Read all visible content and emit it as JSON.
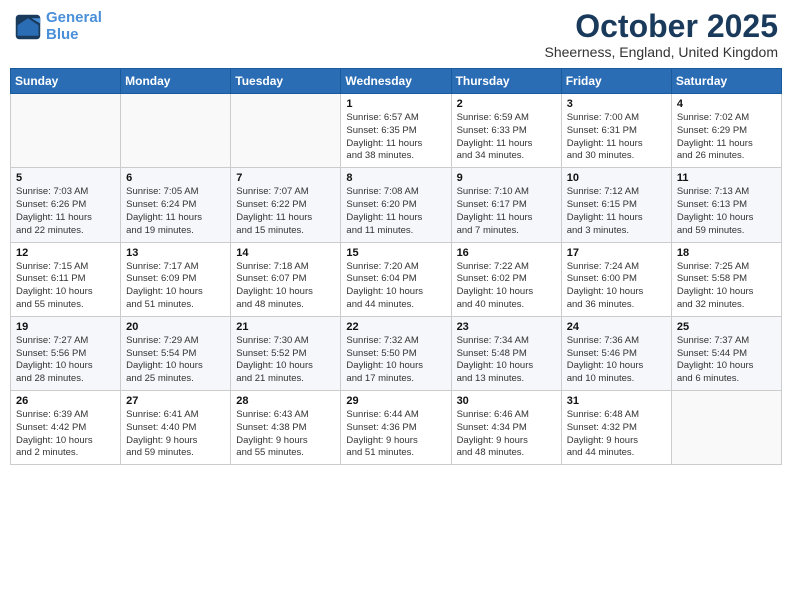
{
  "logo": {
    "line1": "General",
    "line2": "Blue"
  },
  "title": "October 2025",
  "location": "Sheerness, England, United Kingdom",
  "days_of_week": [
    "Sunday",
    "Monday",
    "Tuesday",
    "Wednesday",
    "Thursday",
    "Friday",
    "Saturday"
  ],
  "weeks": [
    [
      {
        "day": "",
        "info": ""
      },
      {
        "day": "",
        "info": ""
      },
      {
        "day": "",
        "info": ""
      },
      {
        "day": "1",
        "info": "Sunrise: 6:57 AM\nSunset: 6:35 PM\nDaylight: 11 hours\nand 38 minutes."
      },
      {
        "day": "2",
        "info": "Sunrise: 6:59 AM\nSunset: 6:33 PM\nDaylight: 11 hours\nand 34 minutes."
      },
      {
        "day": "3",
        "info": "Sunrise: 7:00 AM\nSunset: 6:31 PM\nDaylight: 11 hours\nand 30 minutes."
      },
      {
        "day": "4",
        "info": "Sunrise: 7:02 AM\nSunset: 6:29 PM\nDaylight: 11 hours\nand 26 minutes."
      }
    ],
    [
      {
        "day": "5",
        "info": "Sunrise: 7:03 AM\nSunset: 6:26 PM\nDaylight: 11 hours\nand 22 minutes."
      },
      {
        "day": "6",
        "info": "Sunrise: 7:05 AM\nSunset: 6:24 PM\nDaylight: 11 hours\nand 19 minutes."
      },
      {
        "day": "7",
        "info": "Sunrise: 7:07 AM\nSunset: 6:22 PM\nDaylight: 11 hours\nand 15 minutes."
      },
      {
        "day": "8",
        "info": "Sunrise: 7:08 AM\nSunset: 6:20 PM\nDaylight: 11 hours\nand 11 minutes."
      },
      {
        "day": "9",
        "info": "Sunrise: 7:10 AM\nSunset: 6:17 PM\nDaylight: 11 hours\nand 7 minutes."
      },
      {
        "day": "10",
        "info": "Sunrise: 7:12 AM\nSunset: 6:15 PM\nDaylight: 11 hours\nand 3 minutes."
      },
      {
        "day": "11",
        "info": "Sunrise: 7:13 AM\nSunset: 6:13 PM\nDaylight: 10 hours\nand 59 minutes."
      }
    ],
    [
      {
        "day": "12",
        "info": "Sunrise: 7:15 AM\nSunset: 6:11 PM\nDaylight: 10 hours\nand 55 minutes."
      },
      {
        "day": "13",
        "info": "Sunrise: 7:17 AM\nSunset: 6:09 PM\nDaylight: 10 hours\nand 51 minutes."
      },
      {
        "day": "14",
        "info": "Sunrise: 7:18 AM\nSunset: 6:07 PM\nDaylight: 10 hours\nand 48 minutes."
      },
      {
        "day": "15",
        "info": "Sunrise: 7:20 AM\nSunset: 6:04 PM\nDaylight: 10 hours\nand 44 minutes."
      },
      {
        "day": "16",
        "info": "Sunrise: 7:22 AM\nSunset: 6:02 PM\nDaylight: 10 hours\nand 40 minutes."
      },
      {
        "day": "17",
        "info": "Sunrise: 7:24 AM\nSunset: 6:00 PM\nDaylight: 10 hours\nand 36 minutes."
      },
      {
        "day": "18",
        "info": "Sunrise: 7:25 AM\nSunset: 5:58 PM\nDaylight: 10 hours\nand 32 minutes."
      }
    ],
    [
      {
        "day": "19",
        "info": "Sunrise: 7:27 AM\nSunset: 5:56 PM\nDaylight: 10 hours\nand 28 minutes."
      },
      {
        "day": "20",
        "info": "Sunrise: 7:29 AM\nSunset: 5:54 PM\nDaylight: 10 hours\nand 25 minutes."
      },
      {
        "day": "21",
        "info": "Sunrise: 7:30 AM\nSunset: 5:52 PM\nDaylight: 10 hours\nand 21 minutes."
      },
      {
        "day": "22",
        "info": "Sunrise: 7:32 AM\nSunset: 5:50 PM\nDaylight: 10 hours\nand 17 minutes."
      },
      {
        "day": "23",
        "info": "Sunrise: 7:34 AM\nSunset: 5:48 PM\nDaylight: 10 hours\nand 13 minutes."
      },
      {
        "day": "24",
        "info": "Sunrise: 7:36 AM\nSunset: 5:46 PM\nDaylight: 10 hours\nand 10 minutes."
      },
      {
        "day": "25",
        "info": "Sunrise: 7:37 AM\nSunset: 5:44 PM\nDaylight: 10 hours\nand 6 minutes."
      }
    ],
    [
      {
        "day": "26",
        "info": "Sunrise: 6:39 AM\nSunset: 4:42 PM\nDaylight: 10 hours\nand 2 minutes."
      },
      {
        "day": "27",
        "info": "Sunrise: 6:41 AM\nSunset: 4:40 PM\nDaylight: 9 hours\nand 59 minutes."
      },
      {
        "day": "28",
        "info": "Sunrise: 6:43 AM\nSunset: 4:38 PM\nDaylight: 9 hours\nand 55 minutes."
      },
      {
        "day": "29",
        "info": "Sunrise: 6:44 AM\nSunset: 4:36 PM\nDaylight: 9 hours\nand 51 minutes."
      },
      {
        "day": "30",
        "info": "Sunrise: 6:46 AM\nSunset: 4:34 PM\nDaylight: 9 hours\nand 48 minutes."
      },
      {
        "day": "31",
        "info": "Sunrise: 6:48 AM\nSunset: 4:32 PM\nDaylight: 9 hours\nand 44 minutes."
      },
      {
        "day": "",
        "info": ""
      }
    ]
  ]
}
